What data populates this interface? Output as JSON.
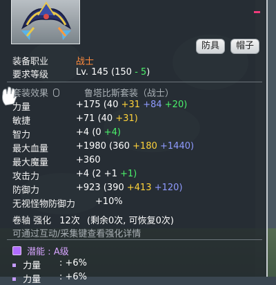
{
  "header": {
    "tags": [
      "防具",
      "帽子"
    ]
  },
  "requirements": [
    {
      "label": "装备职业",
      "value": "战士"
    },
    {
      "label": "要求等级",
      "value": "Lv. 145",
      "detail_open": "(150",
      "detail_minus": "- 5",
      "detail_close": ")"
    }
  ],
  "set_effect": {
    "label": "套装效果",
    "name": "鲁塔比斯套装（战士）"
  },
  "stats": [
    {
      "label": "力量",
      "total": "+175",
      "paren_open": "(40",
      "base_plus": "+31",
      "bonus_blue": "+84",
      "bonus_green": "+20)"
    },
    {
      "label": "敏捷",
      "total": "+71",
      "paren_open": "(40",
      "base_plus": "+31)"
    },
    {
      "label": "智力",
      "total": "+4",
      "paren_open": "(0",
      "bonus_green": "+4)"
    },
    {
      "label": "最大血量",
      "total": "+1980",
      "paren_open": "(360",
      "base_plus": "+180",
      "bonus_blue": "+1440)"
    },
    {
      "label": "最大魔量",
      "total": "+360"
    },
    {
      "label": "攻击力",
      "total": "+4",
      "paren_open": "(2",
      "base_plus_plain": "+1",
      "bonus_green": "+1)"
    },
    {
      "label": "防御力",
      "total": "+923",
      "paren_open": "(390",
      "base_plus": "+413",
      "bonus_blue": "+120)"
    },
    {
      "label": "无视怪物防御力",
      "total": "+10%"
    }
  ],
  "scroll": {
    "label": "卷轴 强化",
    "count": "12次",
    "detail": "(剩余0次, 可恢复0次)"
  },
  "hint": "可通过互动/采集键查看强化详情",
  "potential": {
    "label": "潜能",
    "separator": ":",
    "grade": "A级",
    "lines": [
      {
        "label": "力量",
        "value": ": +6%"
      },
      {
        "label": "力量",
        "value": ": +6%"
      }
    ]
  },
  "colors": {
    "job_red": "#ff8a3c",
    "star_yellow": "#ffd33a",
    "bonus_blue": "#8f9bff",
    "bonus_green": "#4af06a",
    "potential_purple": "#d7a4ff"
  }
}
